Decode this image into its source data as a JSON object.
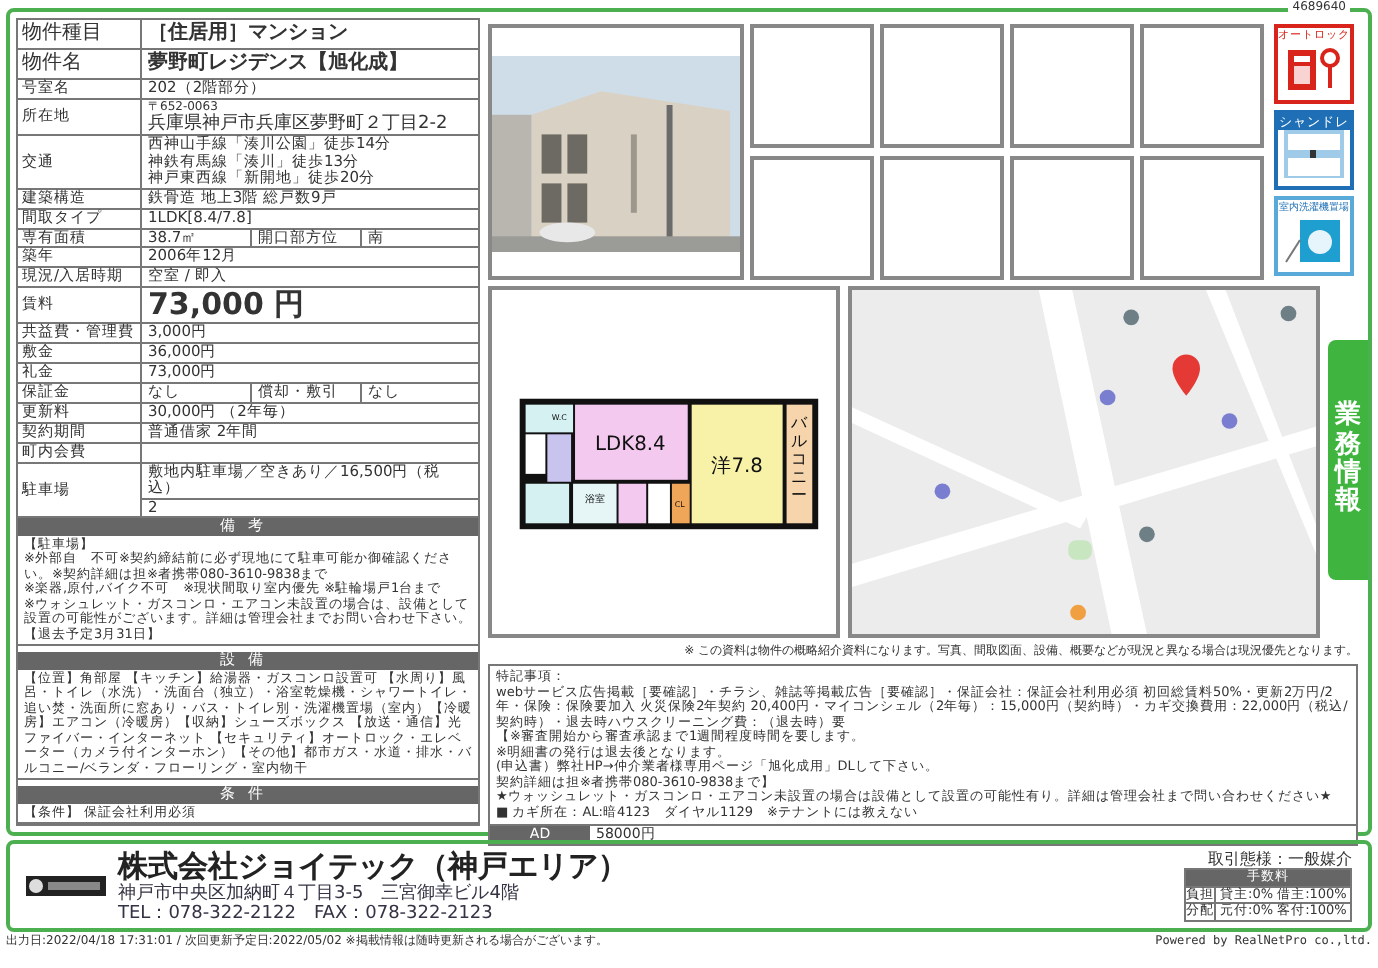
{
  "listing_id": "4689640",
  "property": {
    "rows": [
      {
        "kind": "title",
        "label": "物件種目",
        "value": "［住居用］マンション"
      },
      {
        "kind": "title",
        "label": "物件名",
        "value": "夢野町レジデンス【旭化成】"
      },
      {
        "kind": "text",
        "label": "号室名",
        "value": "202（2階部分）"
      },
      {
        "kind": "address",
        "label": "所在地",
        "postcode": "〒652-0063",
        "value": "兵庫県神戸市兵庫区夢野町２丁目2-2"
      },
      {
        "kind": "lines",
        "label": "交通",
        "lines": [
          "西神山手線「湊川公園」徒歩14分",
          "神鉄有馬線「湊川」徒歩13分",
          "神戸東西線「新開地」徒歩20分"
        ]
      },
      {
        "kind": "text",
        "label": "建築構造",
        "value": "鉄骨造 地上3階 総戸数9戸"
      },
      {
        "kind": "text",
        "label": "間取タイプ",
        "value": "1LDK[8.4/7.8]"
      },
      {
        "kind": "split",
        "label": "専有面積",
        "value": "38.7㎡",
        "label2": "開口部方位",
        "value2": "南"
      },
      {
        "kind": "text",
        "label": "築年",
        "value": "2006年12月"
      },
      {
        "kind": "text",
        "label": "現況/入居時期",
        "value": "空室 / 即入"
      },
      {
        "kind": "rent",
        "label": "賃料",
        "value": "73,000 円"
      },
      {
        "kind": "text",
        "label": "共益費・管理費",
        "value": "3,000円"
      },
      {
        "kind": "text",
        "label": "敷金",
        "value": "36,000円"
      },
      {
        "kind": "text",
        "label": "礼金",
        "value": "73,000円"
      },
      {
        "kind": "split",
        "label": "保証金",
        "value": "なし",
        "label2": "償却・敷引",
        "value2": "なし"
      },
      {
        "kind": "text",
        "label": "更新料",
        "value": "30,000円 （2年毎）"
      },
      {
        "kind": "text",
        "label": "契約期間",
        "value": "普通借家 2年間"
      },
      {
        "kind": "text",
        "label": "町内会費"
      },
      {
        "kind": "stack",
        "label": "駐車場",
        "lines": [
          "敷地内駐車場／空きあり／16,500円（税込）",
          "2"
        ]
      }
    ],
    "sections": [
      {
        "title": "備考",
        "lines": [
          "【駐車場】",
          "※外部自　不可※契約締結前に必ず現地にて駐車可能か御確認ください。※契約詳細は担※者携帯080-3610-9838まで",
          "※楽器,原付,バイク不可　※現状間取り室内優先 ※駐輪場戸1台まで",
          "※ウォシュレット・ガスコンロ・エアコン未設置の場合は、設備として設置の可能性がございます。詳細は管理会社までお問い合わせ下さい。",
          "【退去予定3月31日】"
        ]
      },
      {
        "title": "設備",
        "lines": [
          "【位置】角部屋 【キッチン】給湯器・ガスコンロ設置可 【水周り】風呂・トイレ（水洗）・洗面台（独立）・浴室乾燥機・シャワートイレ・追い焚・洗面所に窓あり・バス・トイレ別・洗濯機置場（室内）【冷暖房】エアコン（冷暖房）【収納】シューズボックス 【放送・通信】光ファイバー・インターネット 【セキュリティ】オートロック・エレベーター（カメラ付インターホン）【その他】都市ガス・水道・排水・バルコニー/ベランダ・フローリング・室内物干"
        ]
      },
      {
        "title": "条件",
        "lines": [
          "【条件】 保証会社利用必須"
        ]
      }
    ]
  },
  "feature_badges": [
    {
      "kind": "lock",
      "label": "オートロック"
    },
    {
      "kind": "vanity",
      "label": "シャンドレ"
    },
    {
      "kind": "laundry",
      "label": "室内洗濯機置場"
    }
  ],
  "side_tab": "業務情報",
  "floor_plan": {
    "ldk": "LDK8.4",
    "bedroom": "洋7.8",
    "balcony": "バルコニー",
    "closet": "CL",
    "bath": "浴室",
    "toilet": "W.C"
  },
  "disclaimer": "※ この資料は物件の概略紹介資料になります。写真、間取図面、設備、概要などが現況と異なる場合は現況優先となります。",
  "special_notes": {
    "title": "特記事項：",
    "lines": [
      "webサービス広告掲載［要確認］・チラシ、雑誌等掲載広告［要確認］・保証会社：保証会社利用必須 初回総賃料50%・更新2万円/2年・保険：保険要加入 火災保険2年契約 20,400円・マイコンシェル（2年毎）：15,000円（契約時）・カギ交換費用：22,000円（税込/契約時）・退去時ハウスクリーニング費：（退去時）要",
      "【※審査開始から審査承認まで1週間程度時間を要します。",
      "※明細書の発行は退去後となります。",
      "(申込書）弊社HP→仲介業者様専用ページ「旭化成用」DLして下さい。",
      "契約詳細は担※者携帯080-3610-9838まで】",
      "★ウォッシュレット・ガスコンロ・エアコン未設置の場合は設備として設置の可能性有り。詳細は管理会社まで問い合わせください★",
      "■ カギ所在：AL:暗4123　ダイヤル1129　※テナントには教えない"
    ],
    "ad_label": "AD",
    "ad_value": "58000円"
  },
  "company": {
    "name": "株式会社ジョイテック（神戸エリア）",
    "address": "神戸市中央区加納町４丁目3-5　三宮御幸ビル4階",
    "contact": "TEL：078-322-2122　FAX：078-322-2123"
  },
  "transaction": {
    "title": "取引態様：一般媒介",
    "fee_header": "手数料",
    "rows": [
      {
        "label": "負担",
        "value": "貸主:0% 借主:100%"
      },
      {
        "label": "分配",
        "value": "元付:0% 客付:100%"
      }
    ]
  },
  "footer": {
    "left": "出力日:2022/04/18 17:31:01 / 次回更新予定日:2022/05/02 ※掲載情報は随時更新される場合がございます。",
    "right": "Powered by RealNetPro co.,ltd."
  }
}
